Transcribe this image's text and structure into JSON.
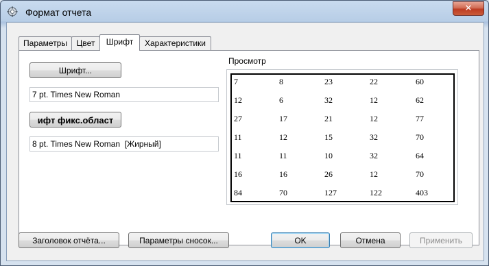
{
  "window": {
    "title": "Формат отчета",
    "close_label": "✕"
  },
  "tabs": [
    {
      "label": "Параметры",
      "active": false
    },
    {
      "label": "Цвет",
      "active": false
    },
    {
      "label": "Шрифт",
      "active": true
    },
    {
      "label": "Характеристики",
      "active": false
    }
  ],
  "font_panel": {
    "font_button_label": "Шрифт...",
    "font_value": "7 pt. Times New Roman",
    "fixed_font_button_label": "ифт фикс.област",
    "fixed_font_value": "8 pt. Times New Roman  [Жирный]"
  },
  "preview": {
    "label": "Просмотр",
    "rows": [
      [
        "7",
        "8",
        "23",
        "22",
        "60"
      ],
      [
        "12",
        "6",
        "32",
        "12",
        "62"
      ],
      [
        "27",
        "17",
        "21",
        "12",
        "77"
      ],
      [
        "11",
        "12",
        "15",
        "32",
        "70"
      ],
      [
        "11",
        "11",
        "10",
        "32",
        "64"
      ],
      [
        "16",
        "16",
        "26",
        "12",
        "70"
      ],
      [
        "84",
        "70",
        "127",
        "122",
        "403"
      ]
    ]
  },
  "footer": {
    "report_header_button": "Заголовок отчёта...",
    "footnote_params_button": "Параметры сносок...",
    "ok_button": "OK",
    "cancel_button": "Отмена",
    "apply_button": "Применить"
  }
}
